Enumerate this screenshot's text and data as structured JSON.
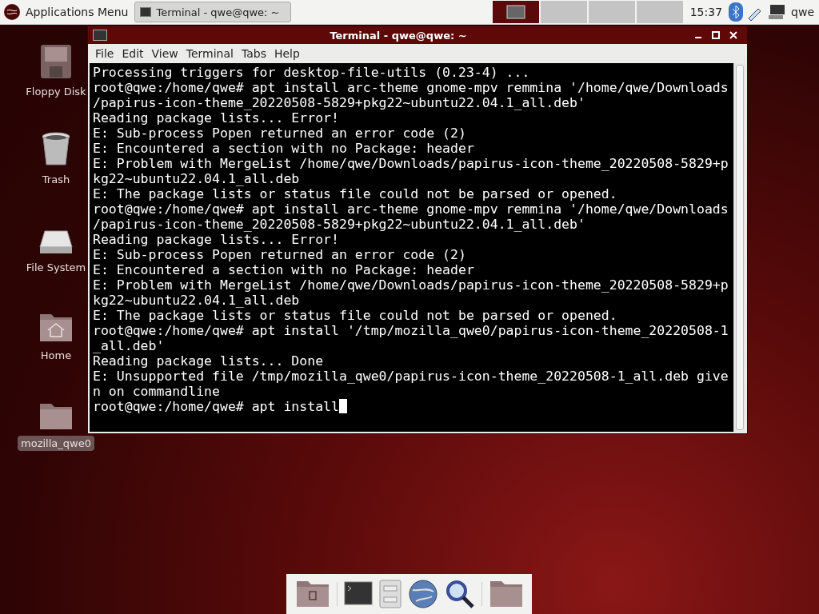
{
  "panel": {
    "app_menu": "Applications Menu",
    "tasks": [
      {
        "label": "Terminal - qwe@qwe: ~",
        "selected": true
      }
    ],
    "workspaces": [
      {
        "selected": true
      },
      {
        "selected": false
      },
      {
        "selected": false
      },
      {
        "selected": false
      }
    ],
    "clock": "15:37",
    "user": "qwe"
  },
  "desktop_icons": [
    {
      "label": "Floppy Disk",
      "kind": "floppy",
      "selected": false
    },
    {
      "label": "Trash",
      "kind": "trash",
      "selected": false
    },
    {
      "label": "File System",
      "kind": "drive",
      "selected": false
    },
    {
      "label": "Home",
      "kind": "home",
      "selected": false
    },
    {
      "label": "mozilla_qwe0",
      "kind": "folder",
      "selected": true
    }
  ],
  "terminal": {
    "title": "Terminal - qwe@qwe: ~",
    "menu": [
      "File",
      "Edit",
      "View",
      "Terminal",
      "Tabs",
      "Help"
    ],
    "lines": [
      "Processing triggers for desktop-file-utils (0.23-4) ...",
      "root@qwe:/home/qwe# apt install arc-theme gnome-mpv remmina '/home/qwe/Downloads",
      "/papirus-icon-theme_20220508-5829+pkg22~ubuntu22.04.1_all.deb'",
      "Reading package lists... Error!",
      "E: Sub-process Popen returned an error code (2)",
      "E: Encountered a section with no Package: header",
      "E: Problem with MergeList /home/qwe/Downloads/papirus-icon-theme_20220508-5829+p",
      "kg22~ubuntu22.04.1_all.deb",
      "E: The package lists or status file could not be parsed or opened.",
      "root@qwe:/home/qwe# apt install arc-theme gnome-mpv remmina '/home/qwe/Downloads",
      "/papirus-icon-theme_20220508-5829+pkg22~ubuntu22.04.1_all.deb'",
      "Reading package lists... Error!",
      "E: Sub-process Popen returned an error code (2)",
      "E: Encountered a section with no Package: header",
      "E: Problem with MergeList /home/qwe/Downloads/papirus-icon-theme_20220508-5829+p",
      "kg22~ubuntu22.04.1_all.deb",
      "E: The package lists or status file could not be parsed or opened.",
      "root@qwe:/home/qwe# apt install '/tmp/mozilla_qwe0/papirus-icon-theme_20220508-1",
      "_all.deb'",
      "Reading package lists... Done",
      "E: Unsupported file /tmp/mozilla_qwe0/papirus-icon-theme_20220508-1_all.deb give",
      "n on commandline"
    ],
    "prompt": "root@qwe:/home/qwe# apt install"
  },
  "dock": [
    {
      "kind": "folder-doc"
    },
    {
      "kind": "separator"
    },
    {
      "kind": "terminal"
    },
    {
      "kind": "cabinet"
    },
    {
      "kind": "globe"
    },
    {
      "kind": "search"
    },
    {
      "kind": "separator"
    },
    {
      "kind": "folder"
    }
  ]
}
